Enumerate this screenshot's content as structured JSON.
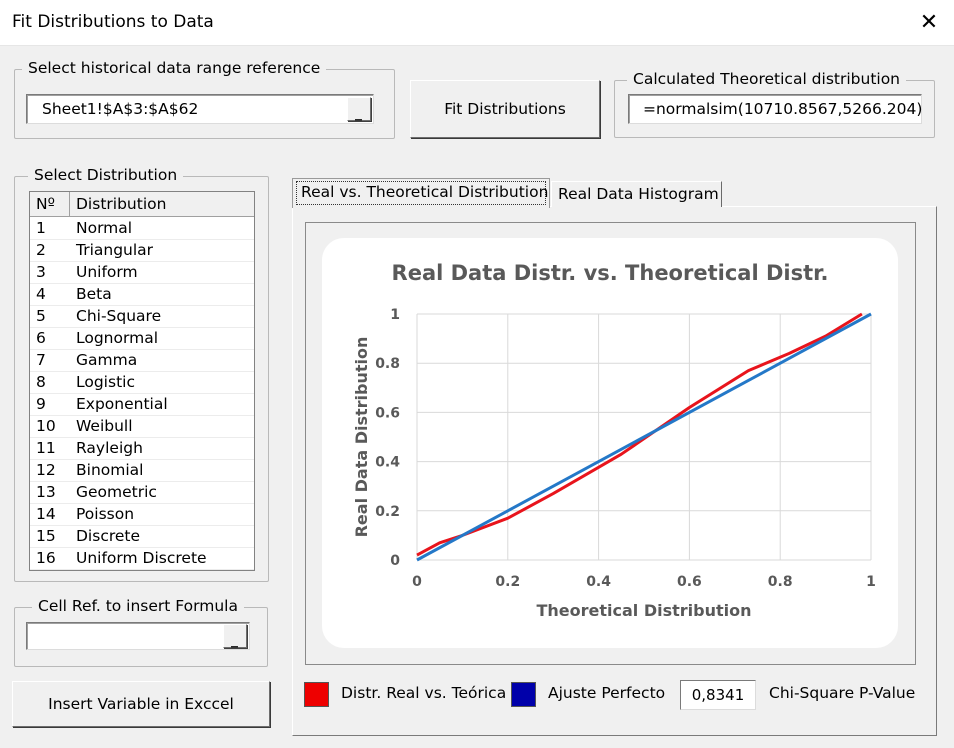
{
  "window": {
    "title": "Fit Distributions to Data",
    "close_icon": "close-icon"
  },
  "range_group": {
    "label": "Select historical data range reference",
    "value": "Sheet1!$A$3:$A$62"
  },
  "fit_button": {
    "label": "Fit Distributions"
  },
  "theoretical_group": {
    "label": "Calculated Theoretical distribution",
    "value": "=normalsim(10710.8567,5266.204)"
  },
  "dist_group": {
    "label": "Select Distribution",
    "col_num": "Nº",
    "col_name": "Distribution",
    "rows": [
      {
        "n": "1",
        "name": "Normal"
      },
      {
        "n": "2",
        "name": "Triangular"
      },
      {
        "n": "3",
        "name": "Uniform"
      },
      {
        "n": "4",
        "name": "Beta"
      },
      {
        "n": "5",
        "name": "Chi-Square"
      },
      {
        "n": "6",
        "name": "Lognormal"
      },
      {
        "n": "7",
        "name": "Gamma"
      },
      {
        "n": "8",
        "name": "Logistic"
      },
      {
        "n": "9",
        "name": "Exponential"
      },
      {
        "n": "10",
        "name": "Weibull"
      },
      {
        "n": "11",
        "name": "Rayleigh"
      },
      {
        "n": "12",
        "name": "Binomial"
      },
      {
        "n": "13",
        "name": "Geometric"
      },
      {
        "n": "14",
        "name": "Poisson"
      },
      {
        "n": "15",
        "name": "Discrete"
      },
      {
        "n": "16",
        "name": "Uniform Discrete"
      }
    ]
  },
  "cell_group": {
    "label": "Cell Ref. to insert Formula",
    "value": ""
  },
  "insert_button": {
    "label": "Insert Variable in Exccel"
  },
  "tabs": [
    {
      "label": "Real vs. Theoretical Distribution",
      "active": true
    },
    {
      "label": "Real Data Histogram",
      "active": false
    }
  ],
  "legend": {
    "real_label": "Distr. Real vs. Teórica",
    "real_color": "#ee0000",
    "perfect_label": "Ajuste Perfecto",
    "perfect_color": "#0000aa",
    "pvalue": "0,8341",
    "pvalue_label": "Chi-Square P-Value"
  },
  "chart_data": {
    "type": "line",
    "title": "Real Data Distr. vs. Theoretical Distr.",
    "xlabel": "Theoretical Distribution",
    "ylabel": "Real Data Distribution",
    "xlim": [
      0,
      1
    ],
    "ylim": [
      0,
      1
    ],
    "x_ticks": [
      "0",
      "0.2",
      "0.4",
      "0.6",
      "0.8",
      "1"
    ],
    "y_ticks": [
      "0",
      "0.2",
      "0.4",
      "0.6",
      "0.8",
      "1"
    ],
    "grid": true,
    "series": [
      {
        "color": "#e8141c",
        "x": [
          0,
          0.05,
          0.1,
          0.2,
          0.3,
          0.45,
          0.6,
          0.73,
          0.82,
          0.9,
          0.98
        ],
        "y": [
          0.02,
          0.07,
          0.1,
          0.17,
          0.27,
          0.43,
          0.62,
          0.77,
          0.84,
          0.91,
          1.0
        ]
      },
      {
        "color": "#2478c8",
        "x": [
          0,
          1
        ],
        "y": [
          0,
          1
        ]
      }
    ]
  }
}
